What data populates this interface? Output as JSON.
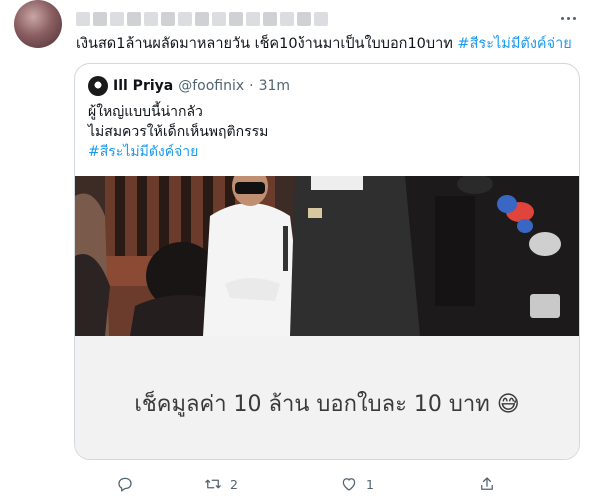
{
  "tweet": {
    "text": "เงินสด1ล้านผลัดมาหลายวัน เช็ค10ง้านมาเป็นใบบอก10บาท",
    "hashtag": "#สีระไม่มีตังค์จ่าย"
  },
  "quoted": {
    "name": "Ill Priya",
    "handle": "@foofinix",
    "separator": "·",
    "time": "31m",
    "lines": [
      "ผู้ใหญ่แบบนี้น่ากลัว",
      "ไม่สมควรให้เด็กเห็นพฤติกรรม",
      "#สีระไม่มีตังค์จ่าย"
    ],
    "media_caption": "เช็คมูลค่า 10 ล้าน บอกใบละ 10 บาท 😅"
  },
  "actions": {
    "reply_count": "",
    "retweet_count": "2",
    "like_count": "1"
  },
  "icons": [
    "more-icon",
    "reply-icon",
    "retweet-icon",
    "like-icon",
    "share-icon"
  ],
  "colors": {
    "link": "#1d9bf0",
    "muted": "#536471",
    "border": "#cfd9de"
  }
}
